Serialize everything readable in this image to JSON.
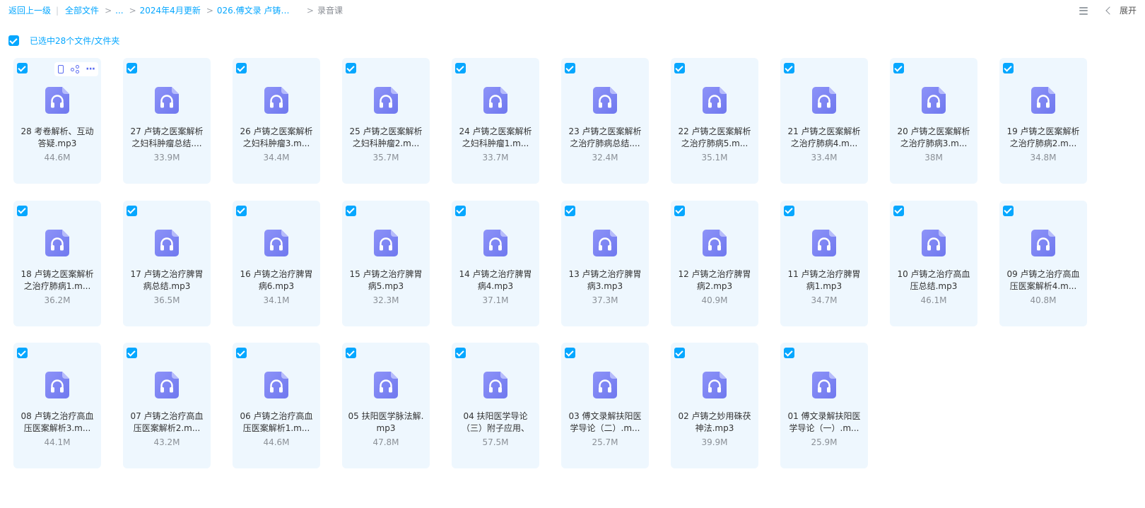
{
  "breadcrumb": {
    "back": "返回上一级",
    "all_files": "全部文件",
    "ellipsis": "...",
    "folder1": "2024年4月更新",
    "folder2": "026.傅文录 卢铸之...",
    "current": "录音课"
  },
  "toolbar": {
    "list_view_icon": "list-view-icon",
    "expand_label": "展开"
  },
  "selection": {
    "text": "已选中28个文件/文件夹",
    "checked": true
  },
  "colors": {
    "accent": "#06a7ff",
    "card_bg": "#eef7fe",
    "icon_purple": "#7f86f5"
  },
  "files": [
    {
      "name": "28 考卷解析、互动答疑.mp3",
      "size": "44.6M"
    },
    {
      "name": "27 卢铸之医案解析之妇科肿瘤总结....",
      "size": "33.9M"
    },
    {
      "name": "26 卢铸之医案解析之妇科肿瘤3.m...",
      "size": "34.4M"
    },
    {
      "name": "25 卢铸之医案解析之妇科肿瘤2.m...",
      "size": "35.7M"
    },
    {
      "name": "24 卢铸之医案解析之妇科肿瘤1.m...",
      "size": "33.7M"
    },
    {
      "name": "23 卢铸之医案解析之治疗肺病总结....",
      "size": "32.4M"
    },
    {
      "name": "22 卢铸之医案解析之治疗肺病5.m...",
      "size": "35.1M"
    },
    {
      "name": "21 卢铸之医案解析之治疗肺病4.m...",
      "size": "33.4M"
    },
    {
      "name": "20 卢铸之医案解析之治疗肺病3.m...",
      "size": "38M"
    },
    {
      "name": "19 卢铸之医案解析之治疗肺病2.m...",
      "size": "34.8M"
    },
    {
      "name": "18 卢铸之医案解析之治疗肺病1.m...",
      "size": "36.2M"
    },
    {
      "name": "17 卢铸之治疗脾胃病总结.mp3",
      "size": "36.5M"
    },
    {
      "name": "16 卢铸之治疗脾胃病6.mp3",
      "size": "34.1M"
    },
    {
      "name": "15 卢铸之治疗脾胃病5.mp3",
      "size": "32.3M"
    },
    {
      "name": "14 卢铸之治疗脾胃病4.mp3",
      "size": "37.1M"
    },
    {
      "name": "13 卢铸之治疗脾胃病3.mp3",
      "size": "37.3M"
    },
    {
      "name": "12 卢铸之治疗脾胃病2.mp3",
      "size": "40.9M"
    },
    {
      "name": "11 卢铸之治疗脾胃病1.mp3",
      "size": "34.7M"
    },
    {
      "name": "10 卢铸之治疗高血压总结.mp3",
      "size": "46.1M"
    },
    {
      "name": "09 卢铸之治疗高血压医案解析4.m...",
      "size": "40.8M"
    },
    {
      "name": "08 卢铸之治疗高血压医案解析3.m...",
      "size": "44.1M"
    },
    {
      "name": "07 卢铸之治疗高血压医案解析2.m...",
      "size": "43.2M"
    },
    {
      "name": "06 卢铸之治疗高血压医案解析1.m...",
      "size": "44.6M"
    },
    {
      "name": "05 扶阳医学脉法解.mp3",
      "size": "47.8M"
    },
    {
      "name": "04 扶阳医学导论（三）附子应用、",
      "size": "57.5M"
    },
    {
      "name": "03 傅文录解扶阳医学导论（二）.m...",
      "size": "25.7M"
    },
    {
      "name": "02 卢铸之妙用硃茯神法.mp3",
      "size": "39.9M"
    },
    {
      "name": "01 傅文录解扶阳医学导论（一）.m...",
      "size": "25.9M"
    }
  ]
}
